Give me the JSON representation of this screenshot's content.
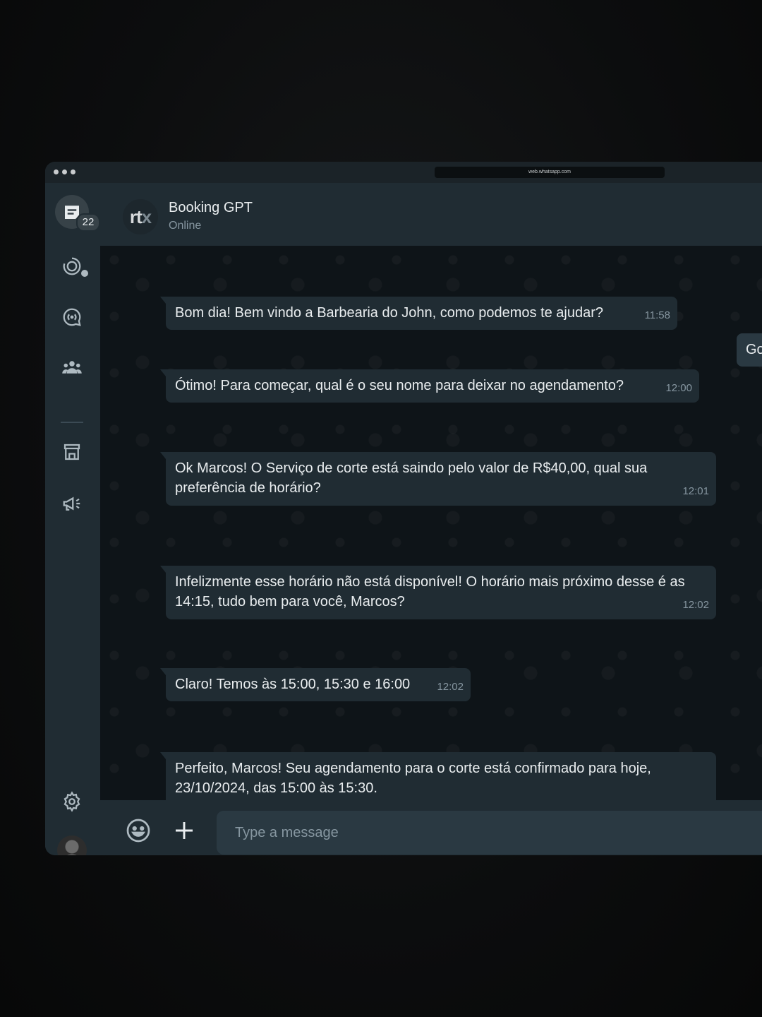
{
  "window": {
    "url": "web.whatsapp.com"
  },
  "rail": {
    "chats_badge": "22",
    "icons": [
      "chats-icon",
      "status-icon",
      "channels-icon",
      "communities-icon",
      "business-tools-icon",
      "marketing-icon",
      "settings-icon"
    ]
  },
  "header": {
    "logo_text": "rt",
    "logo_x": "x",
    "contact_name": "Booking GPT",
    "status": "Online"
  },
  "messages": [
    {
      "text": "Bom dia! Bem vindo a Barbearia do John, como podemos te ajudar?",
      "time": "11:58",
      "direction": "in"
    },
    {
      "text": "Go",
      "time": "",
      "direction": "out"
    },
    {
      "text": "Ótimo! Para começar, qual é o seu nome para deixar no agendamento?",
      "time": "12:00",
      "direction": "in"
    },
    {
      "text": "Ok Marcos! O Serviço de corte está saindo pelo valor de R$40,00, qual sua preferência de horário?",
      "time": "12:01",
      "direction": "in"
    },
    {
      "text": "Infelizmente esse horário não está disponível! O horário mais próximo desse é as 14:15, tudo bem para você, Marcos?",
      "time": "12:02",
      "direction": "in"
    },
    {
      "text": "Claro! Temos às 15:00, 15:30 e 16:00",
      "time": "12:02",
      "direction": "in"
    },
    {
      "text": "Perfeito, Marcos! Seu agendamento para o corte está confirmado para hoje, 23/10/2024, das 15:00 às 15:30.",
      "time": "",
      "direction": "in"
    }
  ],
  "composer": {
    "placeholder": "Type a message"
  },
  "colors": {
    "panel": "#202c33",
    "chat_bg": "#0e1418",
    "bubble_in": "#202c33",
    "text": "#e9edef",
    "meta": "#8696a0"
  }
}
